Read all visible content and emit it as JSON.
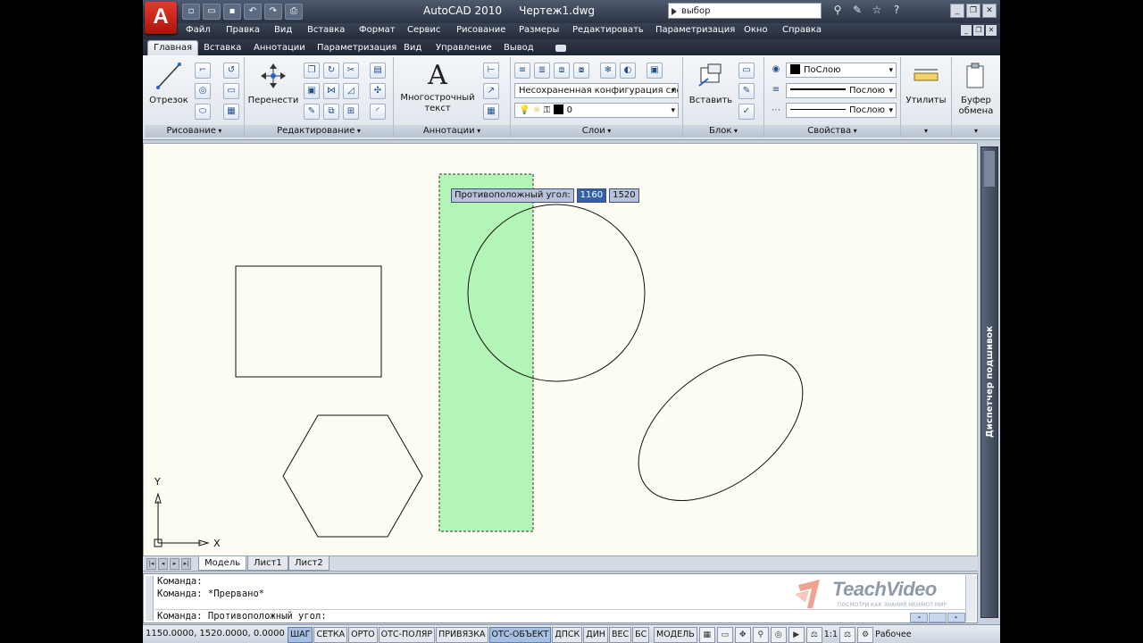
{
  "app": {
    "logo_letter": "A",
    "title": "AutoCAD 2010     Чертеж1.dwg",
    "search_value": "выбор"
  },
  "quick_access": [
    "new-icon",
    "open-icon",
    "save-icon",
    "undo-icon",
    "redo-icon",
    "plot-icon"
  ],
  "title_icons": [
    "binoculars-icon",
    "wrench-icon",
    "star-icon",
    "help-icon"
  ],
  "menu": [
    "Файл",
    "Правка",
    "Вид",
    "Вставка",
    "Формат",
    "Сервис",
    "Рисование",
    "Размеры",
    "Редактировать",
    "Параметризация",
    "Окно",
    "Справка"
  ],
  "ribbon_tabs": [
    "Главная",
    "Вставка",
    "Аннотации",
    "Параметризация",
    "Вид",
    "Управление",
    "Вывод"
  ],
  "ribbon": {
    "draw": {
      "title": "Рисование",
      "line_label": "Отрезок"
    },
    "modify": {
      "title": "Редактирование",
      "move_label": "Перенести"
    },
    "annotation": {
      "title": "Аннотации",
      "mtext_label": "Многострочный текст"
    },
    "layers": {
      "title": "Слои",
      "layer_state": "Несохраненная конфигурация слоев",
      "current_layer": "0"
    },
    "block": {
      "title": "Блок",
      "insert_label": "Вставить"
    },
    "properties": {
      "title": "Свойства",
      "color": "ПоСлою",
      "linetype": "Послою",
      "lineweight": "Послою"
    },
    "utilities_label": "Утилиты",
    "clipboard_label": "Буфер обмена"
  },
  "tooltip": {
    "label": "Противоположный угол:",
    "x_value": "1160",
    "y_value": "1520"
  },
  "ucs": {
    "y_label": "Y",
    "x_label": "X"
  },
  "sheet_tabs": [
    "Модель",
    "Лист1",
    "Лист2"
  ],
  "palette_title": "Диспетчер подшивок",
  "command_window": {
    "line1": "Команда:",
    "line2": "Команда: *Прервано*",
    "prompt": "Команда: Противоположный угол:"
  },
  "watermark": {
    "brand": "TeachVideo",
    "tagline": "ПОСМОТРИ КАК ЗНАНИЯ МЕНЯЮТ МИР"
  },
  "status": {
    "coords": "1150.0000, 1520.0000, 0.0000",
    "toggles": [
      {
        "label": "ШАГ",
        "on": true
      },
      {
        "label": "СЕТКА",
        "on": false
      },
      {
        "label": "ОРТО",
        "on": false
      },
      {
        "label": "ОТС-ПОЛЯР",
        "on": false
      },
      {
        "label": "ПРИВЯЗКА",
        "on": false
      },
      {
        "label": "ОТС-ОБЪЕКТ",
        "on": true
      },
      {
        "label": "ДПСК",
        "on": false
      },
      {
        "label": "ДИН",
        "on": false
      },
      {
        "label": "ВЕС",
        "on": false
      },
      {
        "label": "БС",
        "on": false
      }
    ],
    "model_label": "МОДЕЛЬ",
    "scale_label": "1:1",
    "workspace_label": "Рабочее"
  }
}
